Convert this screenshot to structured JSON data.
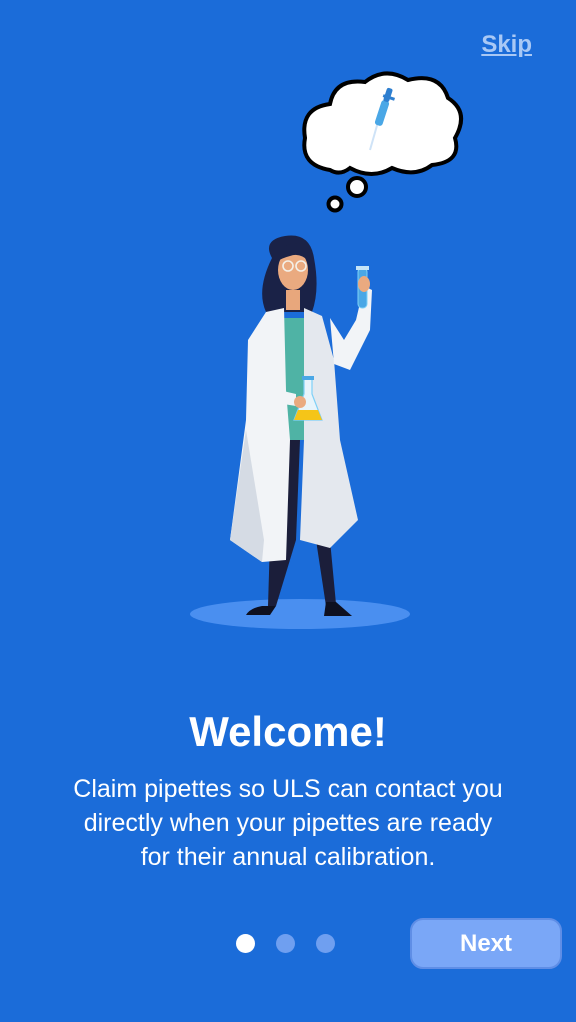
{
  "header": {
    "skip_label": "Skip"
  },
  "onboarding": {
    "title": "Welcome!",
    "description": "Claim pipettes so ULS can contact you\ndirectly when your pipettes are ready\nfor  their annual calibration.",
    "page_count": 3,
    "active_page": 1,
    "next_label": "Next"
  },
  "illustration": {
    "scientist": "scientist-illustration",
    "thought": "pipette-icon"
  },
  "colors": {
    "background": "#1b6cd9",
    "dot_active": "#ffffff",
    "dot_inactive": "#6f9ff0",
    "button": "#7aa7f7",
    "skip_link": "#a9c8f5"
  }
}
